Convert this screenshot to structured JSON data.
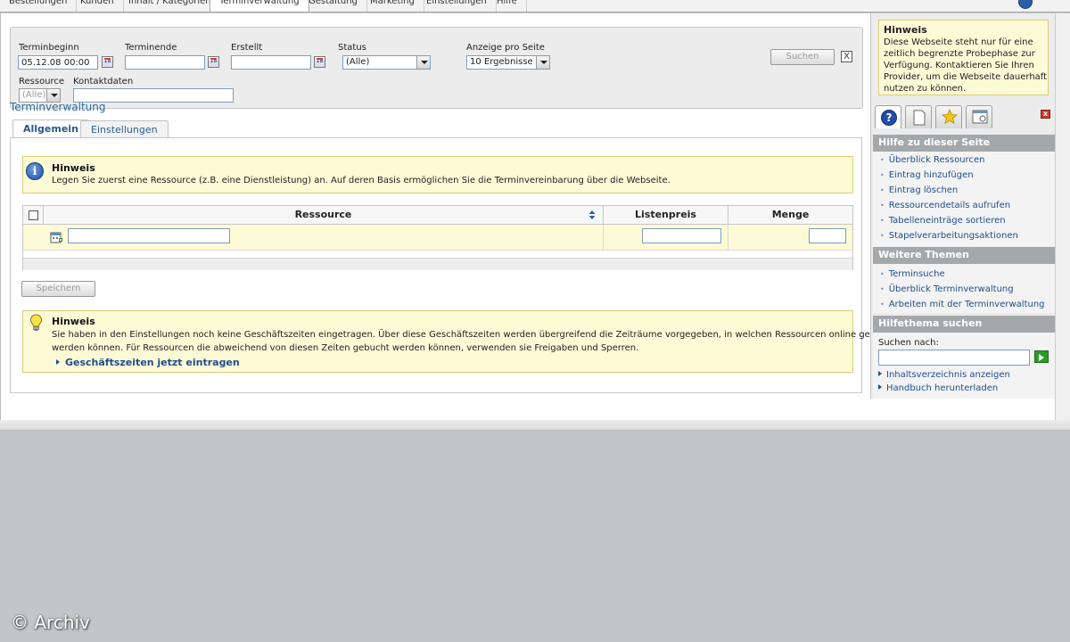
{
  "topnav": {
    "items": [
      "Bestellungen",
      "Kunden",
      "Inhalt / Kategorien",
      "Terminverwaltung",
      "Gestaltung",
      "Marketing",
      "Einstellungen",
      "Hilfe"
    ],
    "active": "Terminverwaltung"
  },
  "filter": {
    "terminbeginn_label": "Terminbeginn",
    "terminbeginn_value": "05.12.08 00:00",
    "terminende_label": "Terminende",
    "terminende_value": "",
    "erstellt_label": "Erstellt",
    "erstellt_value": "",
    "status_label": "Status",
    "status_value": "(Alle)",
    "anzeige_label": "Anzeige pro Seite",
    "anzeige_value": "10 Ergebnisse",
    "ressource_label": "Ressource",
    "ressource_value": "(Alle)",
    "kontaktdaten_label": "Kontaktdaten",
    "kontaktdaten_value": "",
    "search_button": "Suchen",
    "close_symbol": "X",
    "calendar_text": "18"
  },
  "section_title": "Terminverwaltung",
  "tabs": [
    {
      "label": "Allgemein",
      "active": true
    },
    {
      "label": "Einstellungen",
      "active": false
    }
  ],
  "note1": {
    "title": "Hinweis",
    "text": "Legen Sie zuerst eine Ressource (z.B. eine Dienstleistung) an. Auf deren Basis ermöglichen Sie die Terminvereinbarung über die Webseite.",
    "icon_glyph": "i"
  },
  "table": {
    "columns": [
      "Ressource",
      "Listenpreis",
      "Menge"
    ],
    "row": {
      "ressource": "",
      "listenpreis": "",
      "menge": ""
    }
  },
  "save_button": "Speichern",
  "note2": {
    "title": "Hinweis",
    "line1": "Sie haben in den Einstellungen noch keine Geschäftszeiten eingetragen. Über diese Geschäftszeiten werden übergreifend die Zeiträume vorgegeben, in welchen Ressourcen online gebucht",
    "line2": "werden können. Für Ressourcen die abweichend von diesen Zeiten gebucht werden können, verwenden sie Freigaben und Sperren.",
    "link": "Geschäftszeiten jetzt eintragen"
  },
  "sidebar": {
    "hint_title": "Hinweis",
    "hint_text": "Diese Webseite steht nur für eine zeitlich begrenzte Probephase zur Verfügung. Kontaktieren Sie Ihren Provider, um die Webseite dauerhaft nutzen zu können.",
    "help_glyph": "?",
    "close_glyph": "x",
    "section1_title": "Hilfe zu dieser Seite",
    "section1_items": [
      "Überblick Ressourcen",
      "Eintrag hinzufügen",
      "Eintrag löschen",
      "Ressourcendetails aufrufen",
      "Tabelleneinträge sortieren",
      "Stapelverarbeitungsaktionen"
    ],
    "section2_title": "Weitere Themen",
    "section2_items": [
      "Terminsuche",
      "Überblick Terminverwaltung",
      "Arbeiten mit der Terminverwaltung"
    ],
    "section3_title": "Hilfethema suchen",
    "search_label": "Suchen nach:",
    "search_value": "",
    "links": [
      "Inhaltsverzeichnis anzeigen",
      "Handbuch herunterladen"
    ]
  },
  "watermark": "© Archiv",
  "colors": {
    "link": "#1f4e8c",
    "note_bg": "#fdfad6",
    "note_border": "#d9cc7a",
    "sidebar_header": "#a5a8aa",
    "go_button": "#2f9a2a"
  }
}
